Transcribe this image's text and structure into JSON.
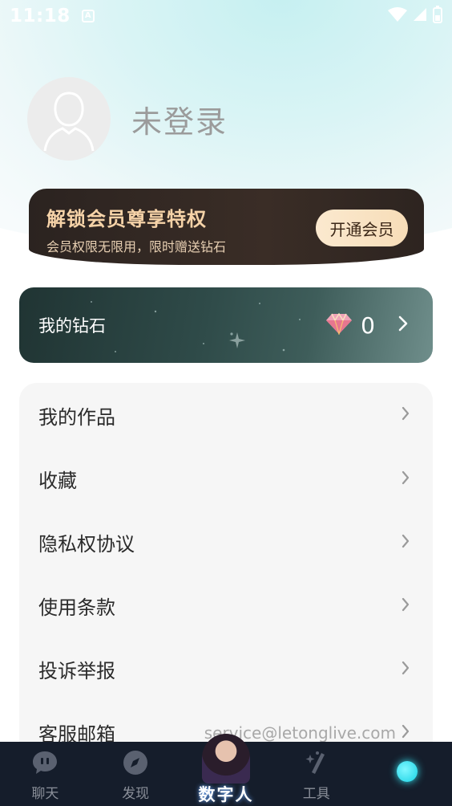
{
  "status_bar": {
    "time": "11:18",
    "notification_icon": "A"
  },
  "profile": {
    "login_text": "未登录"
  },
  "vip": {
    "title": "解锁会员尊享特权",
    "subtitle": "会员权限无限用，限时赠送钻石",
    "button_label": "开通会员"
  },
  "diamond": {
    "label": "我的钻石",
    "count": "0"
  },
  "menu": {
    "items": [
      {
        "label": "我的作品",
        "value": ""
      },
      {
        "label": "收藏",
        "value": ""
      },
      {
        "label": "隐私权协议",
        "value": ""
      },
      {
        "label": "使用条款",
        "value": ""
      },
      {
        "label": "投诉举报",
        "value": ""
      },
      {
        "label": "客服邮箱",
        "value": "service@letonglive.com"
      }
    ]
  },
  "tabbar": {
    "tabs": [
      {
        "label": "聊天",
        "icon": "chat-icon"
      },
      {
        "label": "发现",
        "icon": "compass-icon"
      },
      {
        "label": "数字人",
        "icon": "digital-human-avatar"
      },
      {
        "label": "工具",
        "icon": "magic-wand-icon"
      },
      {
        "label": "",
        "icon": "profile-dot-icon"
      }
    ]
  },
  "colors": {
    "accent_cyan": "#18d2e4",
    "vip_gold": "#f6d3a8",
    "tabbar_bg": "#151d2b"
  }
}
